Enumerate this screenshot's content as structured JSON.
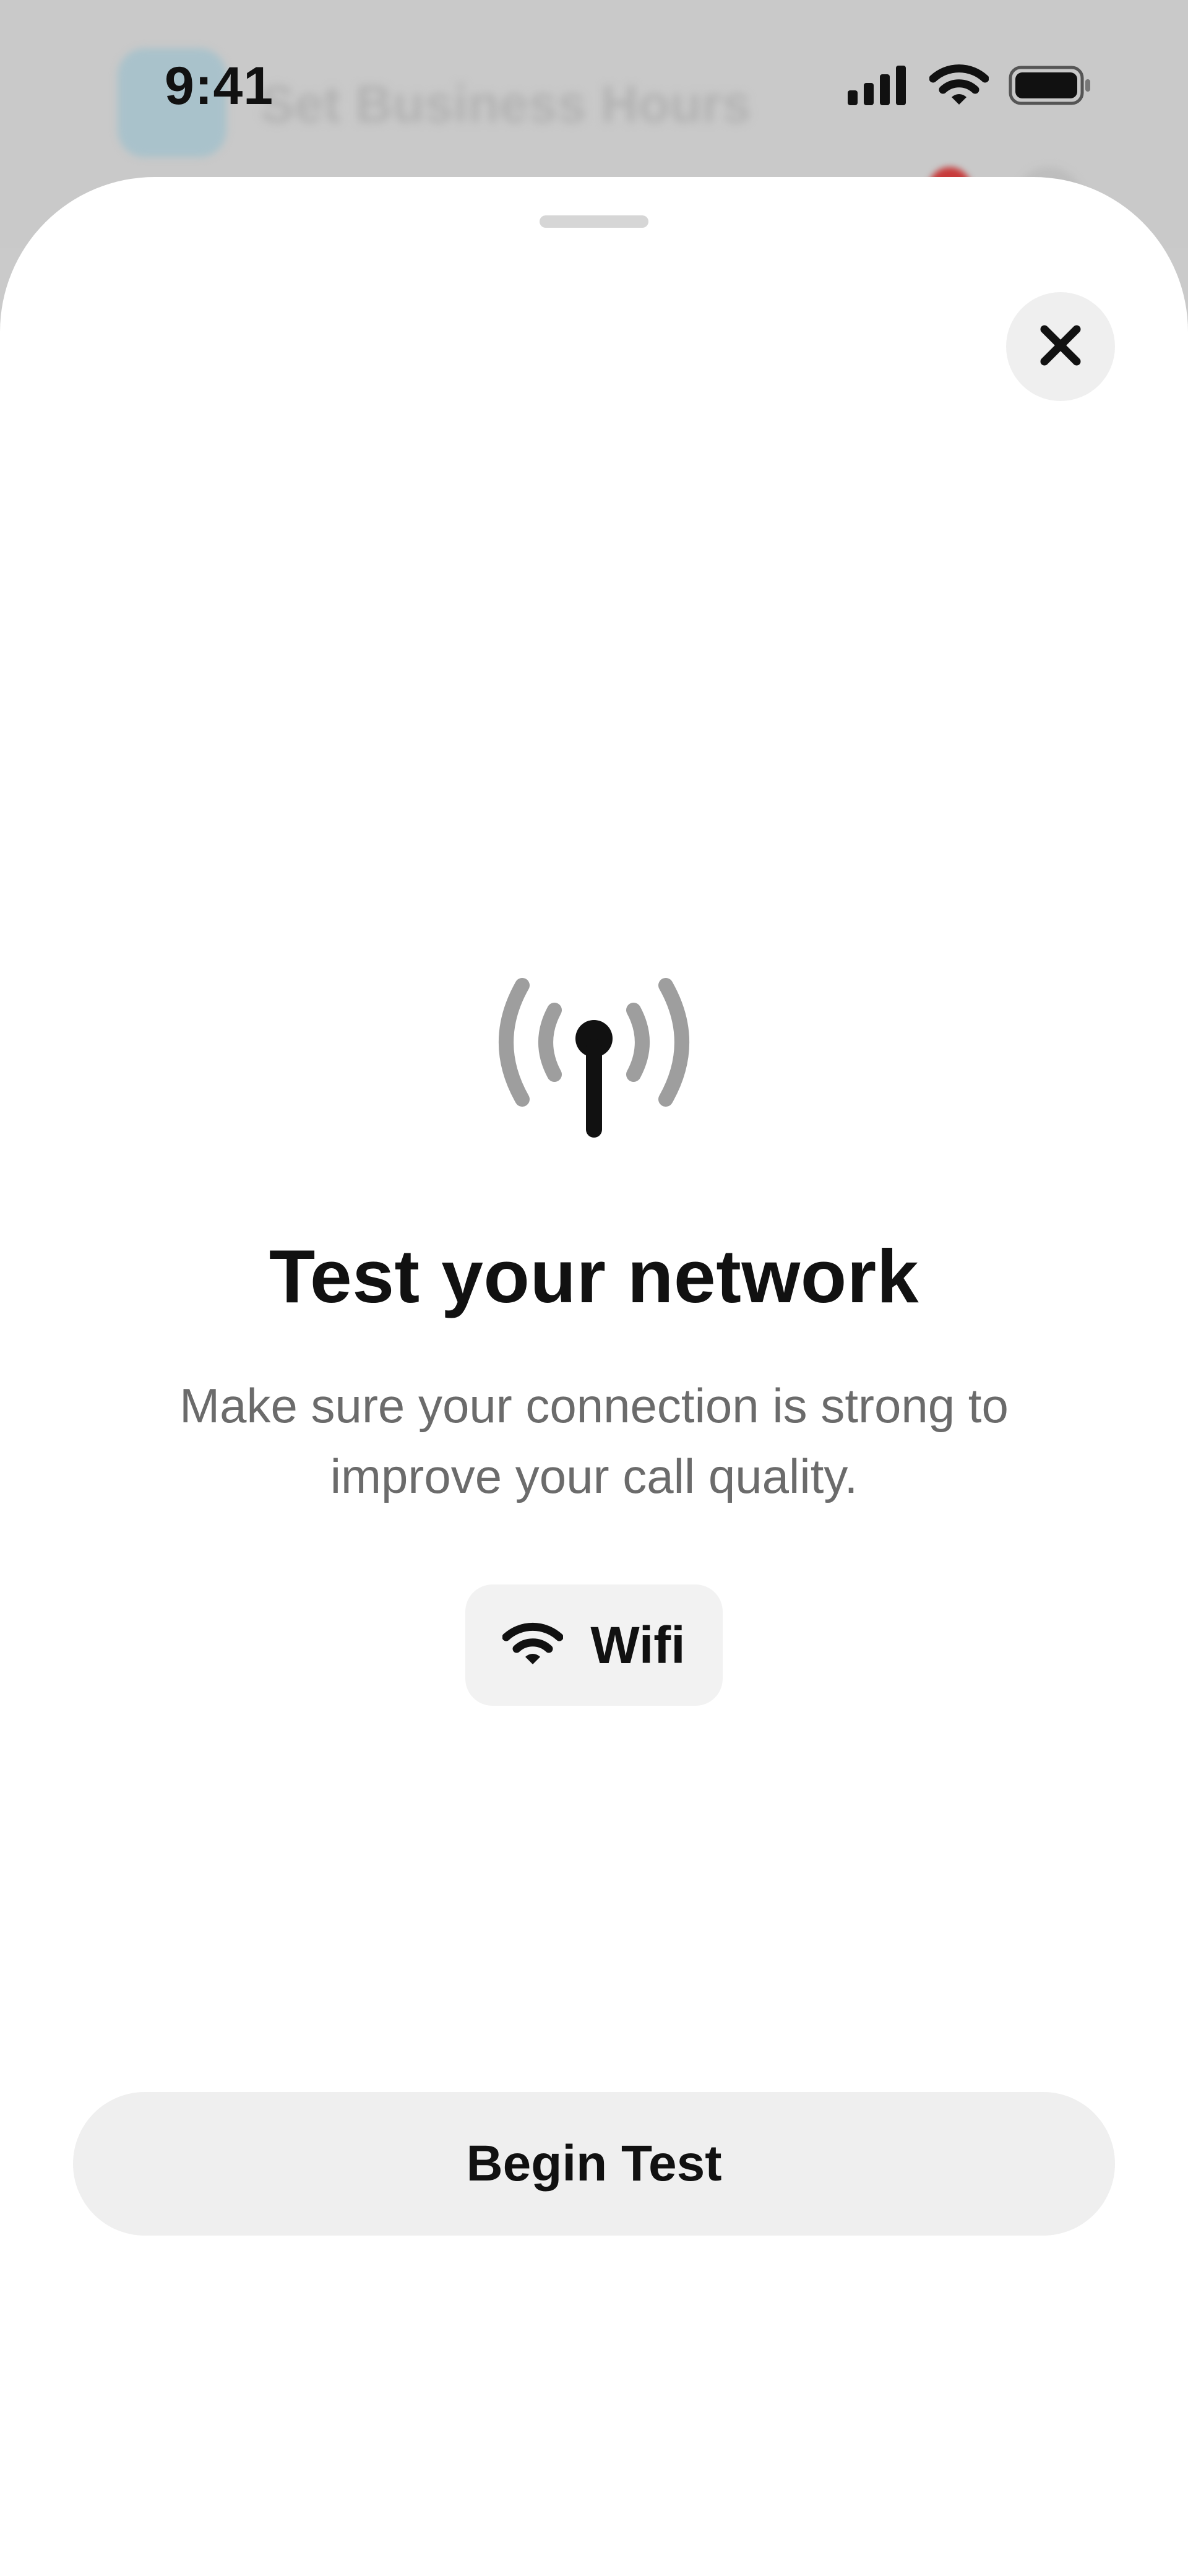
{
  "status_bar": {
    "time": "9:41",
    "icons": [
      "cellular-signal-icon",
      "wifi-icon",
      "battery-icon"
    ]
  },
  "background_app": {
    "title": "Set Business Hours"
  },
  "sheet": {
    "close_icon": "close-icon",
    "illustration_icon": "antenna-signal-icon",
    "title": "Test your network",
    "description": "Make sure your connection is strong to improve your call quality.",
    "network": {
      "icon": "wifi-icon",
      "label": "Wifi"
    },
    "primary_button": "Begin Test"
  },
  "colors": {
    "sheet_background": "#ffffff",
    "backdrop": "#cacaca",
    "button_background": "#efefef",
    "text_primary": "#111111",
    "text_secondary": "#6b6b6b",
    "signal_waves": "#9e9e9e"
  }
}
